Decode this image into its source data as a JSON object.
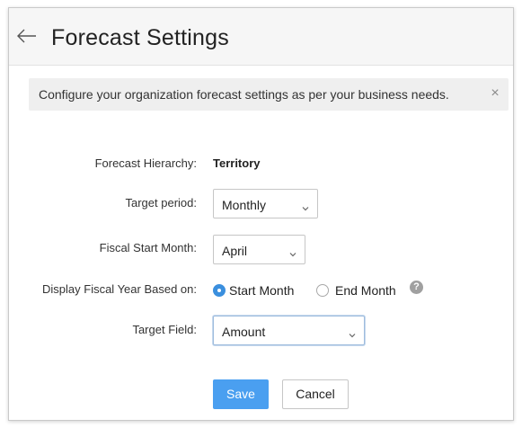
{
  "header": {
    "title": "Forecast Settings",
    "back_icon": "arrow-left-icon"
  },
  "banner": {
    "text": "Configure your organization forecast settings as per your business needs.",
    "close_icon": "close-icon",
    "close_glyph": "×"
  },
  "form": {
    "hierarchy": {
      "label": "Forecast Hierarchy:",
      "value": "Territory"
    },
    "target_period": {
      "label": "Target period:",
      "value": "Monthly"
    },
    "fiscal_start": {
      "label": "Fiscal Start Month:",
      "value": "April"
    },
    "display_fiscal_year": {
      "label": "Display Fiscal Year Based on:",
      "options": [
        {
          "label": "Start Month",
          "selected": true
        },
        {
          "label": "End Month",
          "selected": false
        }
      ],
      "help_glyph": "?"
    },
    "target_field": {
      "label": "Target Field:",
      "value": "Amount"
    }
  },
  "actions": {
    "save_label": "Save",
    "cancel_label": "Cancel"
  },
  "colors": {
    "primary": "#4a9ff0",
    "radio_checked": "#3b8fde",
    "banner_bg": "#efefef",
    "header_bg": "#f6f6f6"
  }
}
